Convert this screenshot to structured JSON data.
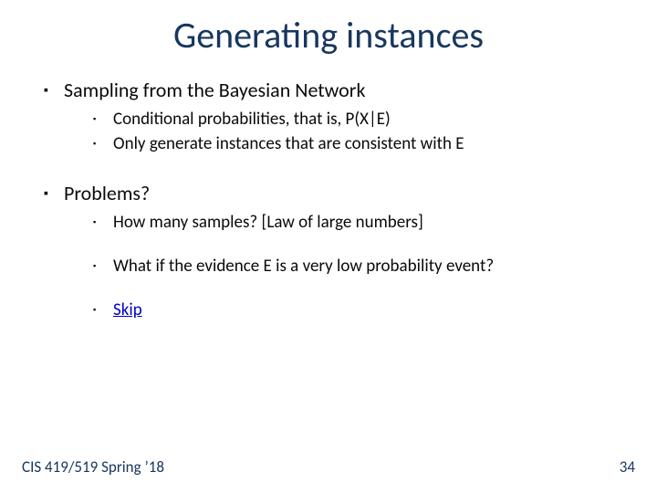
{
  "title": "Generating instances",
  "section1": {
    "heading": "Sampling from the Bayesian Network",
    "items": [
      "Conditional probabilities, that is, P(X|E)",
      "Only generate instances that are consistent with E"
    ]
  },
  "section2": {
    "heading": "Problems?",
    "items": [
      "How many samples? [Law of large numbers]",
      "What if the evidence E is a very low probability event?"
    ],
    "link": "Skip"
  },
  "footer": {
    "left": "CIS 419/519 Spring ’18",
    "right": "34"
  }
}
